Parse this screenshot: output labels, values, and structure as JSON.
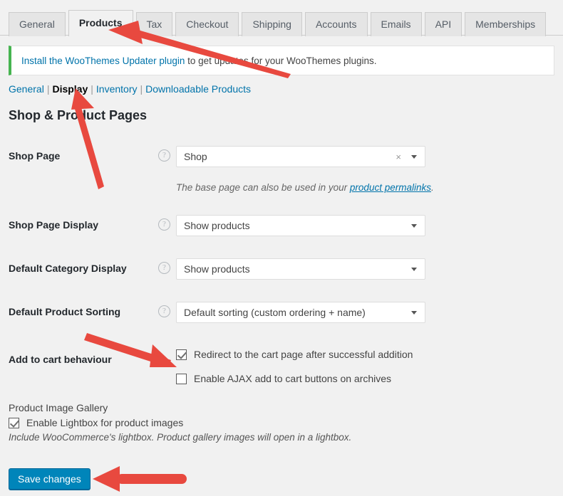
{
  "tabs": [
    {
      "label": "General",
      "active": false
    },
    {
      "label": "Products",
      "active": true
    },
    {
      "label": "Tax",
      "active": false
    },
    {
      "label": "Checkout",
      "active": false
    },
    {
      "label": "Shipping",
      "active": false
    },
    {
      "label": "Accounts",
      "active": false
    },
    {
      "label": "Emails",
      "active": false
    },
    {
      "label": "API",
      "active": false
    },
    {
      "label": "Memberships",
      "active": false
    }
  ],
  "notice": {
    "link_text": "Install the WooThemes Updater plugin",
    "rest_text": " to get updates for your WooThemes plugins."
  },
  "subnav": {
    "items": [
      {
        "label": "General",
        "active": false
      },
      {
        "label": "Display",
        "active": true
      },
      {
        "label": "Inventory",
        "active": false
      },
      {
        "label": "Downloadable Products",
        "active": false
      }
    ],
    "separator": "|"
  },
  "section": {
    "title": "Shop & Product Pages"
  },
  "help_icon": "?",
  "rows": {
    "shop_page": {
      "label": "Shop Page",
      "value": "Shop",
      "clear_icon": "×",
      "description_before": "The base page can also be used in your ",
      "description_link": "product permalinks",
      "description_after": "."
    },
    "shop_page_display": {
      "label": "Shop Page Display",
      "value": "Show products"
    },
    "default_category_display": {
      "label": "Default Category Display",
      "value": "Show products"
    },
    "default_product_sorting": {
      "label": "Default Product Sorting",
      "value": "Default sorting (custom ordering + name)"
    },
    "add_to_cart_behaviour": {
      "label": "Add to cart behaviour",
      "options": [
        {
          "label": "Redirect to the cart page after successful addition",
          "checked": true
        },
        {
          "label": "Enable AJAX add to cart buttons on archives",
          "checked": false
        }
      ]
    }
  },
  "gallery": {
    "title": "Product Image Gallery",
    "checkbox_label": "Enable Lightbox for product images",
    "checked": true,
    "description": "Include WooCommerce's lightbox. Product gallery images will open in a lightbox."
  },
  "save": {
    "label": "Save changes"
  },
  "annotations": {
    "arrow_color": "#e8493f",
    "arrows": [
      {
        "name": "arrow-to-products-tab",
        "points_at": "Products tab"
      },
      {
        "name": "arrow-to-display-link",
        "points_at": "Display sub-nav link"
      },
      {
        "name": "arrow-to-redirect-checkbox",
        "points_at": "Redirect to the cart page checkbox"
      },
      {
        "name": "arrow-to-save-button",
        "points_at": "Save changes button"
      }
    ]
  },
  "colors": {
    "background": "#f1f1f1",
    "accent_blue": "#0073aa",
    "button_blue": "#0085ba",
    "notice_green": "#46b450",
    "arrow_red": "#e8493f"
  }
}
